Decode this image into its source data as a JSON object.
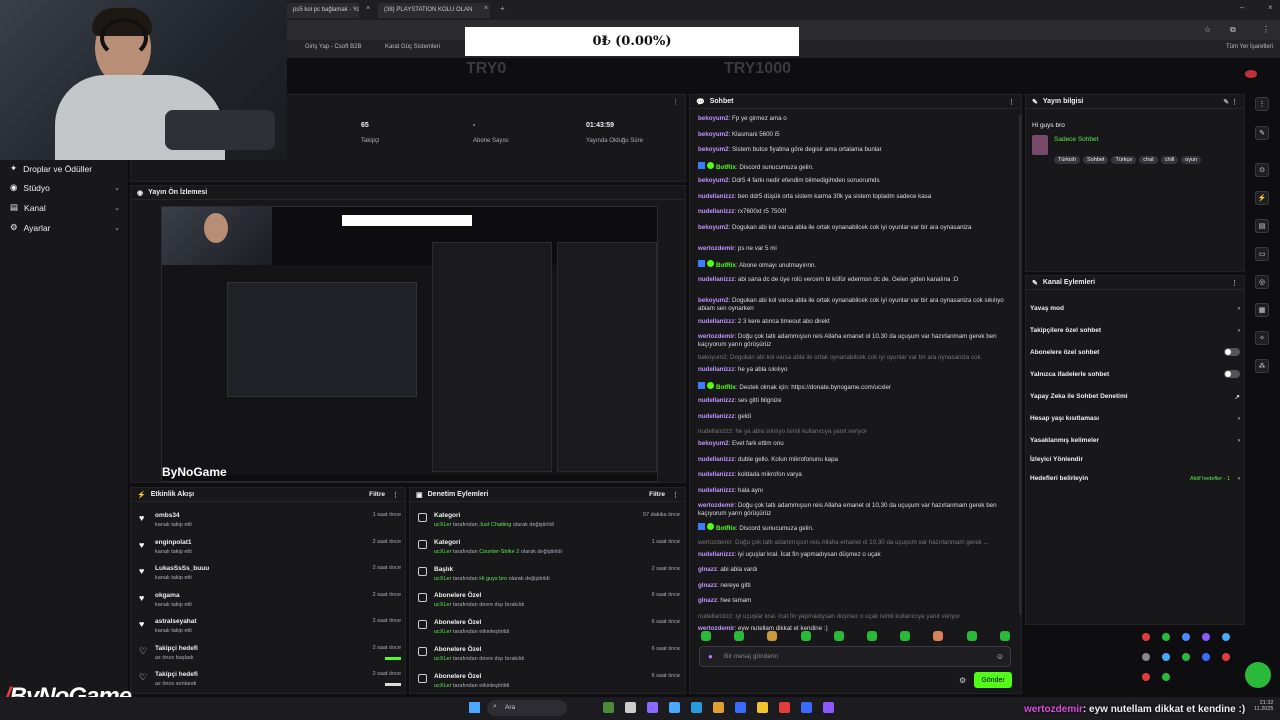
{
  "browser": {
    "tabs": [
      "ps5 kol pc bağlamak - You",
      "(38) PLAYSTATION KOLU OLAN"
    ],
    "bookmarks": [
      "Giriş Yap - Csoft B2B",
      "Karat Güç Sistemleri",
      "Tüm Yer İşaretleri"
    ]
  },
  "overlay": {
    "donation_text": "0₺ (0.00%)",
    "ghost_left": "TRY0",
    "ghost_right": "TRY1000",
    "brand": "ByNoGame",
    "ticker_user": "wertozdemir",
    "ticker_text": ": eyw nutellam dikkat et kendine :)"
  },
  "stats": [
    {
      "value": "65",
      "label": "Takipçi"
    },
    {
      "value": "-",
      "label": "Abone Sayısı"
    },
    {
      "value": "01:43:59",
      "label": "Yayında Olduğu Süre"
    }
  ],
  "leftnav": [
    "Droplar ve Ödüller",
    "Stüdyo",
    "Kanal",
    "Ayarlar"
  ],
  "preview": {
    "title": "Yayın Ön İzlemesi",
    "brand": "ByNoGame"
  },
  "activity": {
    "title": "Etkinlik Akışı",
    "filter": "Filtre",
    "rows": [
      {
        "user": "ombs34",
        "desc": "kanalı takip etti",
        "time": "1 saat önce"
      },
      {
        "user": "enginpolat1",
        "desc": "kanalı takip etti",
        "time": "2 saat önce"
      },
      {
        "user": "LukasSsSs_buuu",
        "desc": "kanalı takip etti",
        "time": "2 saat önce"
      },
      {
        "user": "okgama",
        "desc": "kanalı takip etti",
        "time": "2 saat önce"
      },
      {
        "user": "astralseyahat",
        "desc": "kanalı takip etti",
        "time": "2 saat önce"
      },
      {
        "user": "Takipçi hedefi",
        "desc": "az önce başladı",
        "time": "2 saat önce"
      },
      {
        "user": "Takipçi hedefi",
        "desc": "az önce sonlandı",
        "time": "2 saat önce"
      }
    ]
  },
  "audit": {
    "title": "Denetim Eylemleri",
    "filter": "Filtre",
    "rows": [
      {
        "title": "Kategori",
        "by": "ucXLer",
        "mid": " tarafından ",
        "hl": "Just Chatting",
        "tail": " olarak değiştirildi",
        "time": "57 dakika önce"
      },
      {
        "title": "Kategori",
        "by": "ucXLer",
        "mid": " tarafından ",
        "hl": "Counter-Strike 2",
        "tail": " olarak değiştirildi",
        "time": "1 saat önce"
      },
      {
        "title": "Başlık",
        "by": "ucXLer",
        "mid": " tarafından ",
        "hl": "Hi guys bro",
        "tail": " olarak değiştirildi",
        "time": "2 saat önce"
      },
      {
        "title": "Abonelere Özel",
        "by": "ucXLer",
        "mid": " tarafından devre dışı bırakıldı",
        "hl": "",
        "tail": "",
        "time": "6 saat önce"
      },
      {
        "title": "Abonelere Özel",
        "by": "ucXLer",
        "mid": " tarafından etkinleştirildi",
        "hl": "",
        "tail": "",
        "time": "6 saat önce"
      },
      {
        "title": "Abonelere Özel",
        "by": "ucXLer",
        "mid": " tarafından devre dışı bırakıldı",
        "hl": "",
        "tail": "",
        "time": "6 saat önce"
      },
      {
        "title": "Abonelere Özel",
        "by": "ucXLer",
        "mid": " tarafından etkinleştirildi",
        "hl": "",
        "tail": "",
        "time": "6 saat önce"
      }
    ]
  },
  "chat": {
    "title": "Sohbet",
    "messages": [
      {
        "u": "bekoyum2",
        "m": ": Fp ye girmez ama o"
      },
      {
        "u": "bekoyum2",
        "m": ": Klasmani 5600 i5"
      },
      {
        "u": "bekoyum2",
        "m": ": Sistem butce fiyatina göre degisir ama ortalama bunlar"
      },
      {
        "u": "BotRix",
        "m": ": Discord sunucumuza gelin.",
        "bot": true
      },
      {
        "u": "bekoyum2",
        "m": ": Ddr5 4 farkı nedir efendim bilmedigimden soruorumds"
      },
      {
        "u": "nudellanizzz",
        "m": ": ben ddr5 düşük orta sistem karma 30k ya sistem topladm sadece kasa"
      },
      {
        "u": "nudellanizzz",
        "m": ": rx7600xt r5 7500f"
      },
      {
        "u": "bekoyum2",
        "m": ": Dogukan abi kol varsa abla ile ortak oynanabilcek cok iyi oyunlar var bir ara oynasaniza"
      },
      {
        "u": "wertozdemir",
        "m": ": ps ne var 5 mi"
      },
      {
        "u": "BotRix",
        "m": ": Abone olmayı unutmayınnn.",
        "bot": true
      },
      {
        "u": "nudellanizzz",
        "m": ": abi sana dc de üye rolü vercem bi küfür edermsn dc de. Gelen giden kanalına :D"
      },
      {
        "u": "bekoyum2",
        "m": ": Dogukan abi kol varsa abla ile ortak oynanabilcek cok iyi oyunlar var bir ara oynasaniza cok sıkılıyo abiam sen oynarken"
      },
      {
        "u": "nudellanizzz",
        "m": ": 2 3 kere atınca timeout abo direkt"
      },
      {
        "u": "wertozdemir",
        "m": ": Doğu çok tatlı adammışsın reis Allaha emanet ol 10,30 da uçuşum var hazırlanmam gerek ben kaçıyorum yarın görüşürüz"
      },
      {
        "u": "",
        "m": "bekoyum2: Dogukan abi kol varsa abla ile ortak oynanabilcek cok iyi oyunlar var bir ara oynasaniza cok",
        "sys": true
      },
      {
        "u": "nudellanizzz",
        "m": ": he ya abla sıkılıyo"
      },
      {
        "u": "BotRix",
        "m": ": Destek olmak için: https://donate.bynogame.com/ucxler",
        "bot": true
      },
      {
        "u": "nudellanizzz",
        "m": ": ses gitti bilgnize"
      },
      {
        "u": "nudellanizzz",
        "m": ": geldi"
      },
      {
        "u": "",
        "m": "nudellanizzz: he ya abla sıkılıyo isimli kullanıcıya yanıt veriyor",
        "sys": true
      },
      {
        "u": "bekoyum2",
        "m": ": Evet fark ettim onu"
      },
      {
        "u": "nudellanizzz",
        "m": ": duble gello. Kolun mikrofonunu kapa"
      },
      {
        "u": "nudellanizzz",
        "m": ": koldada mikrofon varya"
      },
      {
        "u": "nudellanizzz",
        "m": ": hala aynı"
      },
      {
        "u": "wertozdemir",
        "m": ": Doğu çok tatlı adammışsın reis Allaha emanet ol 10,30 da uçuşum var hazırlanmam gerek ben kaçıyorum yarın görüşürüz"
      },
      {
        "u": "BotRix",
        "m": ": Discord sunucumuza gelin.",
        "bot": true
      },
      {
        "u": "",
        "m": "wertozdemir: Doğu çok tatlı adammışsın reis Allaha emanet ol 10,30 da uçuşum var hazırlanmam gerek ...",
        "sys": true
      },
      {
        "u": "nudellanizzz",
        "m": ": iyi uçuşlar kral. İcat fin yapmadıysan düşmez o uçak"
      },
      {
        "u": "glnazz",
        "m": ": abi abla vardı"
      },
      {
        "u": "glnazz",
        "m": ": nereye gitti"
      },
      {
        "u": "glnazz",
        "m": ": hee tamam"
      },
      {
        "u": "",
        "m": "nudellanizzz: iyi uçuşlar kral. İcat fin yapmadıysan düşmez o uçak isimli kullanıcıya yanıt veriyor",
        "sys": true
      },
      {
        "u": "wertozdemir",
        "m": ": eyw nutellam dikkat et kendine :)"
      }
    ],
    "placeholder": "Bir mesaj gönderin",
    "send": "Gönder"
  },
  "stream_info": {
    "title": "Yayın bilgisi",
    "stream_title": "Hi guys bro",
    "category": "Sadece Sohbet",
    "tags": [
      "Türkish",
      "Sohbet",
      "Türkçe",
      "chat",
      "chill",
      "oyun"
    ]
  },
  "channel_actions": {
    "title": "Kanal Eylemleri",
    "items": [
      "Yavaş mod",
      "Takipçilere özel sohbet",
      "Abonelere özel sohbet",
      "Yalnızca ifadelerle sohbet",
      "Yapay Zeka ile Sohbet Denetimi",
      "Hesap yaşı kısıtlaması",
      "Yasaklanmış kelimeler",
      "İzleyici Yönlendir",
      "Hedefleri belirleyin"
    ],
    "goal_status": "Aktif hedefler - 1"
  },
  "taskbar": {
    "search": "Ara",
    "time": "21:32",
    "date": "11.2025"
  },
  "colors": {
    "accent": "#53fc18",
    "bg": "#0e0e10",
    "panel": "#18181b"
  }
}
